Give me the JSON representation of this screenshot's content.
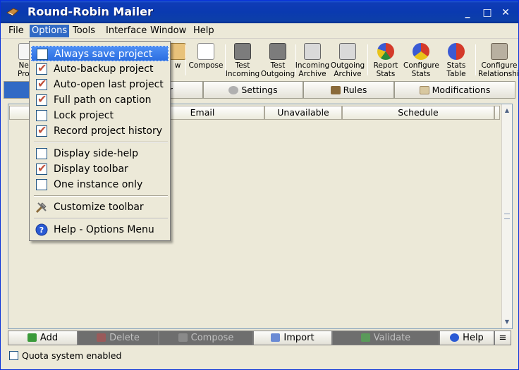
{
  "window": {
    "title": "Round-Robin Mailer",
    "controls": [
      "_",
      "□",
      "✕"
    ]
  },
  "menubar": {
    "items": [
      "File",
      "Options",
      "Tools",
      "Interface",
      "Window",
      "Help"
    ],
    "active": "Options"
  },
  "toolbar": {
    "tools": [
      {
        "label1": "New",
        "label2": "Proje",
        "icon": "new-project-icon"
      },
      {
        "label1": "",
        "label2": "w",
        "icon": "view-icon"
      },
      {
        "label1": "Compose",
        "label2": "",
        "icon": "compose-icon"
      },
      {
        "label1": "Test",
        "label2": "Incoming",
        "icon": "test-incoming-icon"
      },
      {
        "label1": "Test",
        "label2": "Outgoing",
        "icon": "test-outgoing-icon"
      },
      {
        "label1": "Incoming",
        "label2": "Archive",
        "icon": "incoming-archive-icon"
      },
      {
        "label1": "Outgoing",
        "label2": "Archive",
        "icon": "outgoing-archive-icon"
      },
      {
        "label1": "Report",
        "label2": "Stats",
        "icon": "report-stats-icon"
      },
      {
        "label1": "Configure",
        "label2": "Stats",
        "icon": "configure-stats-icon"
      },
      {
        "label1": "Stats",
        "label2": "Table",
        "icon": "stats-table-icon"
      },
      {
        "label1": "Configure",
        "label2": "Relationships",
        "icon": "configure-relationships-icon"
      }
    ]
  },
  "tabs": [
    "",
    "er",
    "Settings",
    "Rules",
    "Modifications"
  ],
  "grid": {
    "columns": [
      "Email",
      "Unavailable",
      "Schedule"
    ]
  },
  "actions": [
    {
      "label": "Add",
      "disabled": false
    },
    {
      "label": "Delete",
      "disabled": true
    },
    {
      "label": "Compose",
      "disabled": true
    },
    {
      "label": "Import",
      "disabled": false
    },
    {
      "label": "Validate",
      "disabled": true
    },
    {
      "label": "Help",
      "disabled": false
    }
  ],
  "status": {
    "quota_label": "Quota system enabled"
  },
  "options_menu": {
    "group1": [
      {
        "label": "Always save project",
        "checked": false
      },
      {
        "label": "Auto-backup project",
        "checked": true
      },
      {
        "label": "Auto-open last project",
        "checked": true
      },
      {
        "label": "Full path on caption",
        "checked": true
      },
      {
        "label": "Lock project",
        "checked": false
      },
      {
        "label": "Record project history",
        "checked": true
      }
    ],
    "group2": [
      {
        "label": "Display side-help",
        "checked": false
      },
      {
        "label": "Display toolbar",
        "checked": true
      },
      {
        "label": "One instance only",
        "checked": false
      }
    ],
    "customize": "Customize toolbar",
    "help": "Help - Options Menu"
  },
  "colors": {
    "titlebar": "#0a3ab0",
    "menu_highlight": "#316ac5",
    "check": "#c0503a",
    "face": "#ece9d8"
  }
}
